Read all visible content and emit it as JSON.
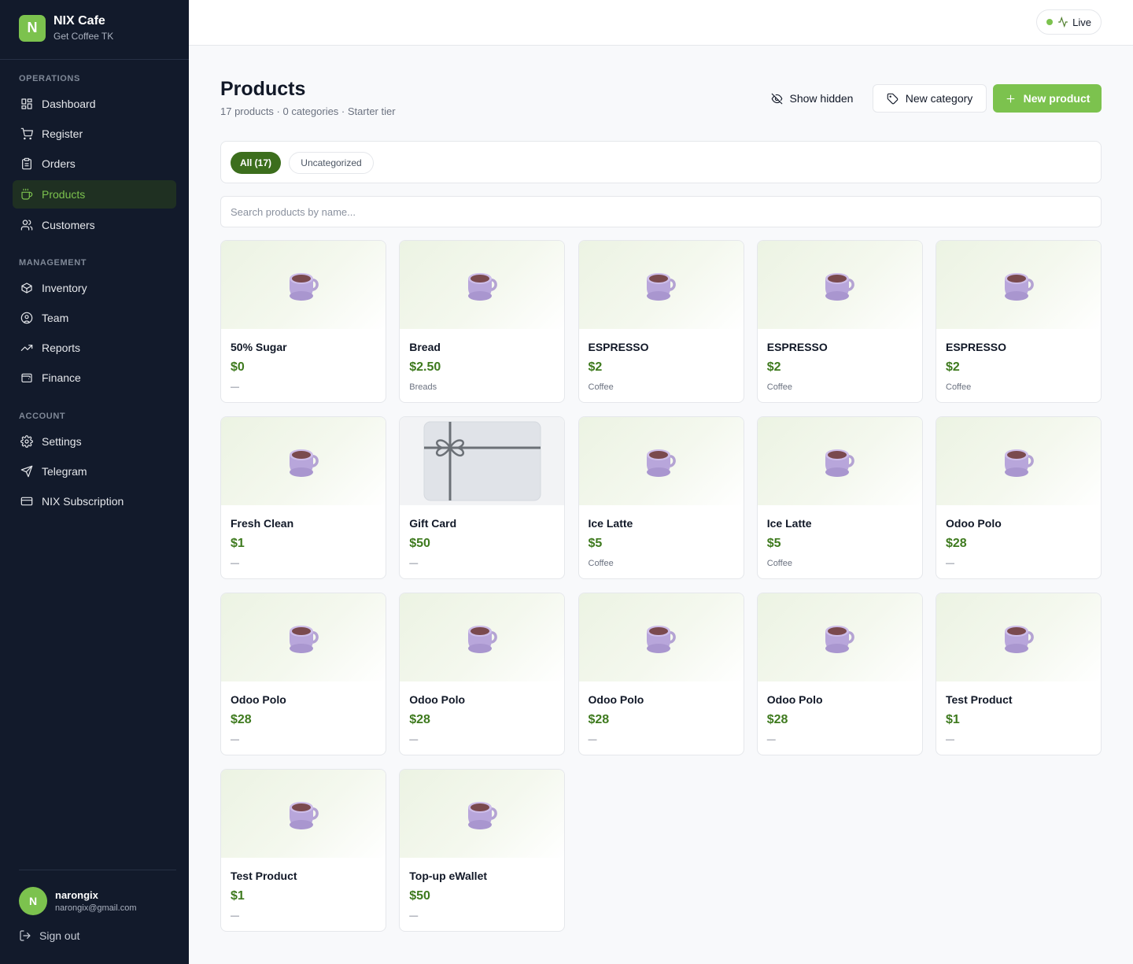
{
  "brand": {
    "logo_letter": "N",
    "name": "NIX Cafe",
    "subtitle": "Get Coffee TK"
  },
  "sidebar": {
    "sections": [
      {
        "label": "OPERATIONS"
      },
      {
        "label": "MANAGEMENT"
      },
      {
        "label": "ACCOUNT"
      }
    ],
    "items": [
      {
        "label": "Dashboard",
        "icon": "dashboard-icon"
      },
      {
        "label": "Register",
        "icon": "cart-icon"
      },
      {
        "label": "Orders",
        "icon": "clipboard-icon"
      },
      {
        "label": "Products",
        "icon": "cup-icon",
        "active": true
      },
      {
        "label": "Customers",
        "icon": "users-icon"
      },
      {
        "label": "Inventory",
        "icon": "box-icon"
      },
      {
        "label": "Team",
        "icon": "user-circle-icon"
      },
      {
        "label": "Reports",
        "icon": "trend-up-icon"
      },
      {
        "label": "Finance",
        "icon": "wallet-icon"
      },
      {
        "label": "Settings",
        "icon": "gear-icon"
      },
      {
        "label": "Telegram",
        "icon": "send-icon"
      },
      {
        "label": "NIX Subscription",
        "icon": "card-icon"
      }
    ],
    "user": {
      "initial": "N",
      "name": "narongix",
      "email": "narongix@gmail.com"
    },
    "signout_label": "Sign out"
  },
  "topbar": {
    "live_label": "Live"
  },
  "header": {
    "title": "Products",
    "subtitle": "17 products · 0 categories · Starter tier",
    "show_hidden_label": "Show hidden",
    "new_category_label": "New category",
    "new_product_label": "New product"
  },
  "filters": {
    "all_label": "All (17)",
    "uncategorized_label": "Uncategorized"
  },
  "search": {
    "placeholder": "Search products by name..."
  },
  "products": [
    {
      "name": "50% Sugar",
      "price": "$0",
      "category": "—",
      "image": "coffee-cup-icon"
    },
    {
      "name": "Bread",
      "price": "$2.50",
      "category": "Breads",
      "image": "coffee-cup-icon"
    },
    {
      "name": "ESPRESSO",
      "price": "$2",
      "category": "Coffee",
      "image": "coffee-cup-icon"
    },
    {
      "name": "ESPRESSO",
      "price": "$2",
      "category": "Coffee",
      "image": "coffee-cup-icon"
    },
    {
      "name": "ESPRESSO",
      "price": "$2",
      "category": "Coffee",
      "image": "coffee-cup-icon"
    },
    {
      "name": "Fresh Clean",
      "price": "$1",
      "category": "—",
      "image": "coffee-cup-icon"
    },
    {
      "name": "Gift Card",
      "price": "$50",
      "category": "—",
      "image": "gift-card-icon"
    },
    {
      "name": "Ice Latte",
      "price": "$5",
      "category": "Coffee",
      "image": "coffee-cup-icon"
    },
    {
      "name": "Ice Latte",
      "price": "$5",
      "category": "Coffee",
      "image": "coffee-cup-icon"
    },
    {
      "name": "Odoo Polo",
      "price": "$28",
      "category": "—",
      "image": "coffee-cup-icon"
    },
    {
      "name": "Odoo Polo",
      "price": "$28",
      "category": "—",
      "image": "coffee-cup-icon"
    },
    {
      "name": "Odoo Polo",
      "price": "$28",
      "category": "—",
      "image": "coffee-cup-icon"
    },
    {
      "name": "Odoo Polo",
      "price": "$28",
      "category": "—",
      "image": "coffee-cup-icon"
    },
    {
      "name": "Odoo Polo",
      "price": "$28",
      "category": "—",
      "image": "coffee-cup-icon"
    },
    {
      "name": "Test Product",
      "price": "$1",
      "category": "—",
      "image": "coffee-cup-icon"
    },
    {
      "name": "Test Product",
      "price": "$1",
      "category": "—",
      "image": "coffee-cup-icon"
    },
    {
      "name": "Top-up eWallet",
      "price": "$50",
      "category": "—",
      "image": "coffee-cup-icon"
    }
  ],
  "colors": {
    "sidebar_bg": "#121a2b",
    "accent": "#7cc24e",
    "accent_dark": "#3c6e1d",
    "price": "#3e7a1e"
  }
}
